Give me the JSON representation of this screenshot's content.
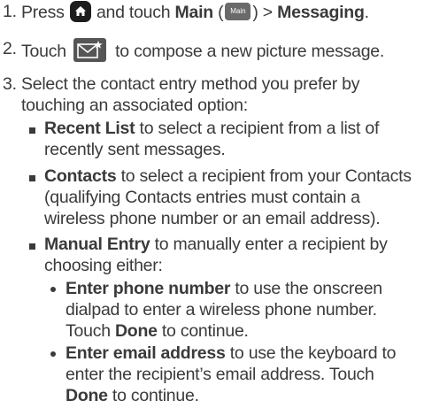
{
  "steps": [
    {
      "number": "1.",
      "text_a": "Press",
      "main_label": "Main",
      "paren_open": "(",
      "main_icon_text": "Main",
      "paren_close": ")",
      "arrow": ">",
      "messaging_label": "Messaging",
      "period": "."
    },
    {
      "number": "2.",
      "text_a": "Touch",
      "text_b": "to compose a new picture message."
    },
    {
      "number": "3.",
      "line1": "Select the contact entry method you prefer by",
      "line2": "touching an associated option:",
      "options": [
        {
          "label": "Recent List",
          "line1": "to select a recipient from a list of",
          "line2": "recently sent messages."
        },
        {
          "label": "Contacts",
          "line1": "to select a recipient from your Contacts",
          "line2": "(qualifying Contacts entries must contain a",
          "line3": "wireless phone number or an email address)."
        },
        {
          "label": "Manual Entry",
          "line1": "to manually enter a recipient by",
          "line2": "choosing either:",
          "choices": [
            {
              "label": "Enter phone number",
              "line1": "to use the onscreen",
              "line2": "dialpad to enter a wireless phone number.",
              "line3a": "Touch",
              "done": "Done",
              "line3b": "to continue."
            },
            {
              "label": "Enter email address",
              "line1": "to use the keyboard to",
              "line2": "enter the recipient’s email address. Touch",
              "done": "Done",
              "line3b": "to continue."
            }
          ]
        }
      ]
    }
  ],
  "colors": {
    "text": "#3a3a3a",
    "icon_dark": "#1d1d1d",
    "icon_gray": "#6a6a6a"
  },
  "icons": [
    "home-icon",
    "main-menu-icon",
    "compose-message-icon"
  ]
}
